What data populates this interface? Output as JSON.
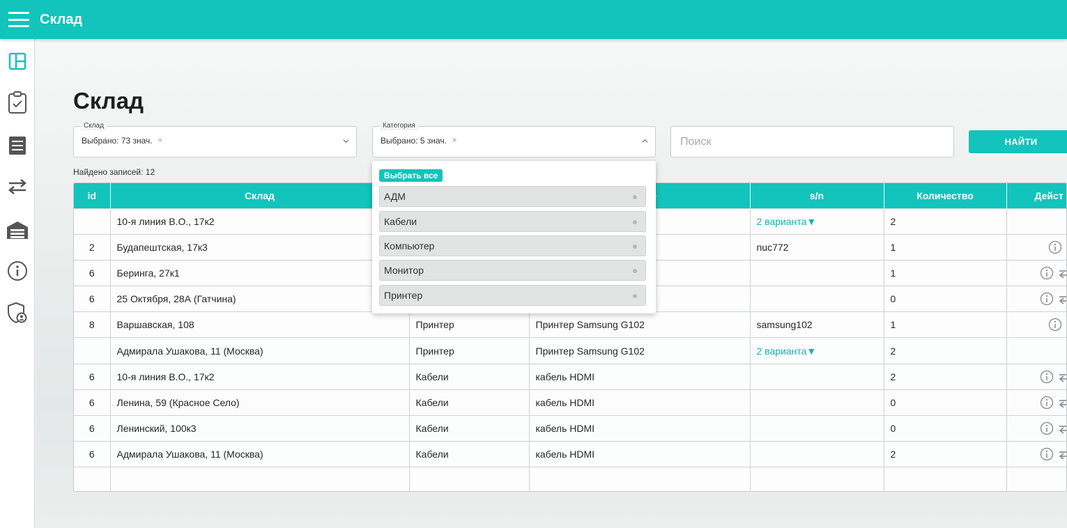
{
  "header": {
    "title": "Склад"
  },
  "sidebar": {
    "items": [
      {
        "name": "dashboard-icon"
      },
      {
        "name": "clipboard-check-icon"
      },
      {
        "name": "list-icon"
      },
      {
        "name": "transfer-icon"
      },
      {
        "name": "warehouse-icon"
      },
      {
        "name": "info-icon"
      },
      {
        "name": "shield-user-icon"
      }
    ]
  },
  "page": {
    "title": "Склад",
    "found": "Найдено записей: 12"
  },
  "filters": {
    "warehouse": {
      "label": "Склад",
      "value": "Выбрано: 73 знач."
    },
    "category": {
      "label": "Категория",
      "value": "Выбрано: 5 знач."
    },
    "search": {
      "placeholder": "Поиск"
    },
    "find_button": "НАЙТИ"
  },
  "dropdown": {
    "select_all": "Выбрать все",
    "options": [
      "АДМ",
      "Кабели",
      "Компьютер",
      "Монитор",
      "Принтер"
    ]
  },
  "table": {
    "headers": [
      "id",
      "Склад",
      "",
      "ание",
      "s/n",
      "Количество",
      "Дейст"
    ],
    "rows": [
      {
        "id": "",
        "warehouse": "10-я линия В.О., 17к2",
        "category": "",
        "name": "",
        "sn": "2 варианта▼",
        "qty": "2"
      },
      {
        "id": "2",
        "warehouse": "Будапештская, 17к3",
        "category": "",
        "name": "",
        "sn": "nuc772",
        "qty": "1"
      },
      {
        "id": "6",
        "warehouse": "Беринга, 27к1",
        "category": "",
        "name": "",
        "sn": "",
        "qty": "1"
      },
      {
        "id": "6",
        "warehouse": "25 Октября, 28А (Гатчина)",
        "category": "",
        "name": "",
        "sn": "",
        "qty": "0"
      },
      {
        "id": "8",
        "warehouse": "Варшавская, 108",
        "category": "Принтер",
        "name": "Принтер Samsung G102",
        "sn": "samsung102",
        "qty": "1"
      },
      {
        "id": "",
        "warehouse": "Адмирала Ушакова, 11 (Москва)",
        "category": "Принтер",
        "name": "Принтер Samsung G102",
        "sn": "2 варианта▼",
        "qty": "2"
      },
      {
        "id": "6",
        "warehouse": "10-я линия В.О., 17к2",
        "category": "Кабели",
        "name": "кабель HDMI",
        "sn": "",
        "qty": "2"
      },
      {
        "id": "6",
        "warehouse": "Ленина, 59 (Красное Село)",
        "category": "Кабели",
        "name": "кабель HDMI",
        "sn": "",
        "qty": "0"
      },
      {
        "id": "6",
        "warehouse": "Ленинский, 100к3",
        "category": "Кабели",
        "name": "кабель HDMI",
        "sn": "",
        "qty": "0"
      },
      {
        "id": "6",
        "warehouse": "Адмирала Ушакова, 11 (Москва)",
        "category": "Кабели",
        "name": "кабель HDMI",
        "sn": "",
        "qty": "2"
      },
      {
        "id": "",
        "warehouse": "",
        "category": "",
        "name": "",
        "sn": "",
        "qty": ""
      }
    ]
  },
  "colors": {
    "accent": "#12c4bb",
    "link": "#12b5ad"
  }
}
